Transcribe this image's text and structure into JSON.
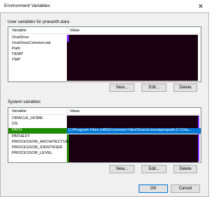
{
  "window": {
    "title": "Environment Variables",
    "close": "✕"
  },
  "user_section": {
    "label": "User variables for prasanth.dara",
    "columns": [
      "Variable",
      "Value"
    ],
    "rows": [
      {
        "name": "OneDrive"
      },
      {
        "name": "OneDriveCommercial"
      },
      {
        "name": "Path"
      },
      {
        "name": "TEMP"
      },
      {
        "name": "TMP"
      }
    ],
    "buttons": {
      "new": "New...",
      "edit": "Edit...",
      "delete": "Delete"
    }
  },
  "system_section": {
    "label": "System variables",
    "columns": [
      "Variable",
      "Value"
    ],
    "rows": [
      {
        "name": "ORACLE_HOME"
      },
      {
        "name": "OS"
      },
      {
        "name": "PATH",
        "value": "C:\\Program Files (x86)\\Common Files\\Oracle\\Java\\javapath;C:\\Ora..."
      },
      {
        "name": "PATHEXT"
      },
      {
        "name": "PROCESSOR_ARCHITECTURE"
      },
      {
        "name": "PROCESSOR_IDENTIFIER"
      },
      {
        "name": "PROCESSOR_LEVEL"
      }
    ],
    "buttons": {
      "new": "New...",
      "edit": "Edit...",
      "delete": "Delete"
    }
  },
  "footer": {
    "ok": "OK",
    "cancel": "Cancel"
  },
  "colors": {
    "selection": "#0078d7",
    "redaction": "#190010",
    "green": "#1f8a00",
    "purple": "#7b2cff"
  }
}
